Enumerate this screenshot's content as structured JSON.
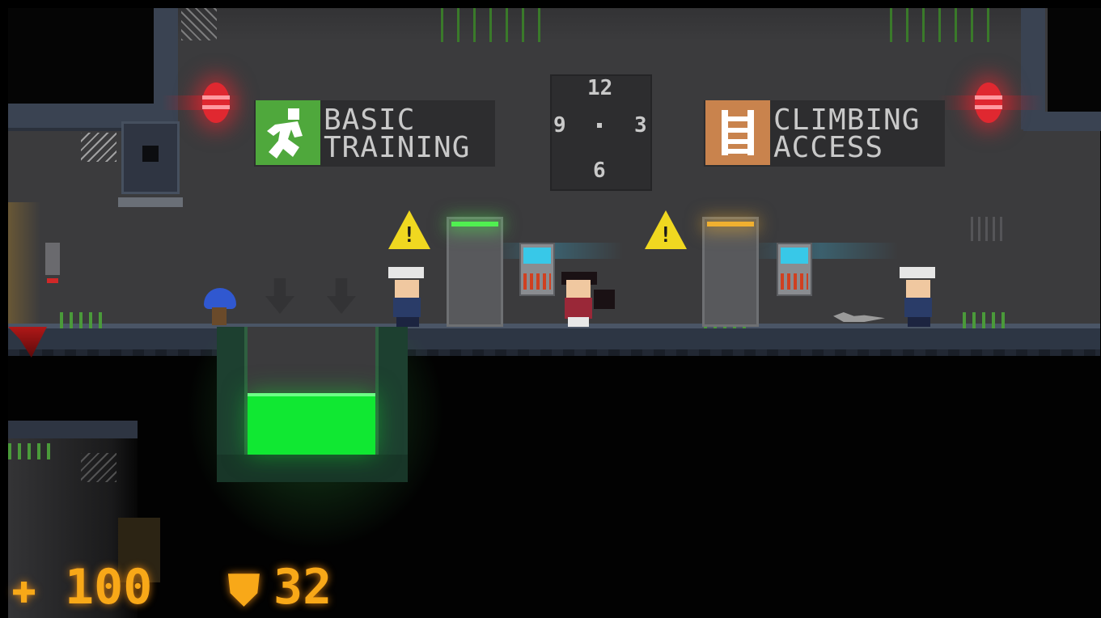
{
  "signs": {
    "basic_training": {
      "line1": "BASIC",
      "line2": "TRAINING",
      "icon": "running-man-icon",
      "icon_color": "#4fa83c"
    },
    "climbing_access": {
      "line1": "CLIMBING",
      "line2": "ACCESS",
      "icon": "ladder-icon",
      "icon_color": "#c9834d"
    }
  },
  "clock": {
    "top": "12",
    "left": "9",
    "right": "3",
    "bottom": "6"
  },
  "hud": {
    "health": {
      "icon": "health-cross-icon",
      "value": "100"
    },
    "armor": {
      "icon": "armor-shield-icon",
      "value": "32"
    },
    "color": "#f8a818"
  },
  "colors": {
    "acid": "#10e832",
    "alarm": "#e02830",
    "door_light_green": "#50f050",
    "door_light_yellow": "#f0b030",
    "warning": "#f0d820"
  }
}
